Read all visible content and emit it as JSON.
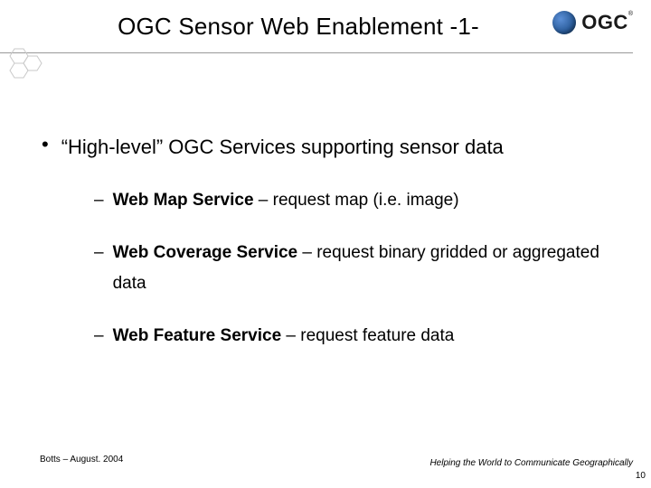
{
  "header": {
    "title": "OGC Sensor Web Enablement -1-",
    "logo_text": "OGC",
    "logo_reg": "®"
  },
  "main": {
    "bullet_dot": "•",
    "bullet_text": "“High-level” OGC Services supporting sensor data",
    "items": [
      {
        "dash": "–",
        "bold": "Web Map Service",
        "rest": " – request map (i.e. image)"
      },
      {
        "dash": "–",
        "bold": "Web Coverage Service",
        "rest": " – request binary gridded or aggregated data"
      },
      {
        "dash": "–",
        "bold": "Web Feature Service",
        "rest": " – request feature data"
      }
    ]
  },
  "footer": {
    "left": "Botts – August. 2004",
    "right": "Helping the World to Communicate Geographically",
    "page": "10"
  }
}
